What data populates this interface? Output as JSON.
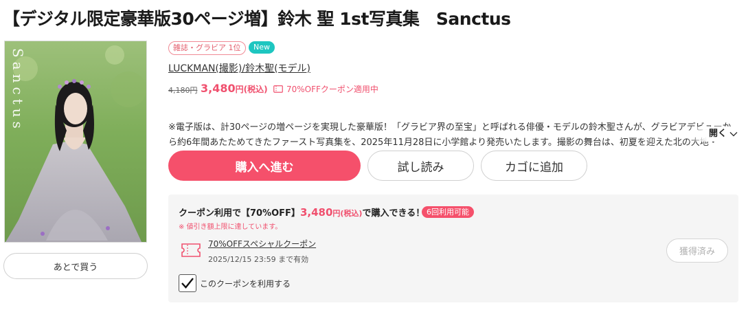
{
  "product": {
    "title": "【デジタル限定豪華版30ページ増】鈴木 聖 1st写真集　Sanctus",
    "cover_text": "Sanctus",
    "rank_badge": "雑誌・グラビア 1位",
    "new_badge": "New",
    "authors": "LUCKMAN(撮影)/鈴木聖(モデル)",
    "original_price": "4,180円",
    "price": "3,480",
    "price_unit": "円(税込)",
    "coupon_note": "70%OFFクーポン適用中",
    "description": "※電子版は、計30ページの増ページを実現した豪華版！「グラビア界の至宝」と呼ばれる俳優・モデルの鈴木聖さんが、グラビアデビューから約6年間あたためてきたファースト写真集を、2025年11月28日に小学館より発売いたします。撮影の舞台は、初夏を迎えた北の大地・",
    "open_label": "開く"
  },
  "actions": {
    "later": "あとで買う",
    "buy": "購入へ進む",
    "trial": "試し読み",
    "cart": "カゴに追加"
  },
  "coupon": {
    "head_prefix": "クーポン利用で【70%OFF】",
    "head_price": "3,480",
    "head_price_unit": "円(税込)",
    "head_suffix": "で購入できる！",
    "usage_badge": "6回利用可能",
    "warning": "※ 値引き額上限に達しています。",
    "name": "70%OFFスペシャルクーポン",
    "expiry": "2025/12/15 23:59 まで有効",
    "obtained": "獲得済み",
    "use_label": "このクーポンを利用する",
    "use_checked": true
  },
  "colors": {
    "accent": "#f5506b",
    "price": "#f0506e",
    "new_badge": "#1ec6c0"
  },
  "icons": {
    "coupon_ticket": "ticket-icon",
    "expand": "chevron-down-icon",
    "check": "checkmark-icon"
  }
}
